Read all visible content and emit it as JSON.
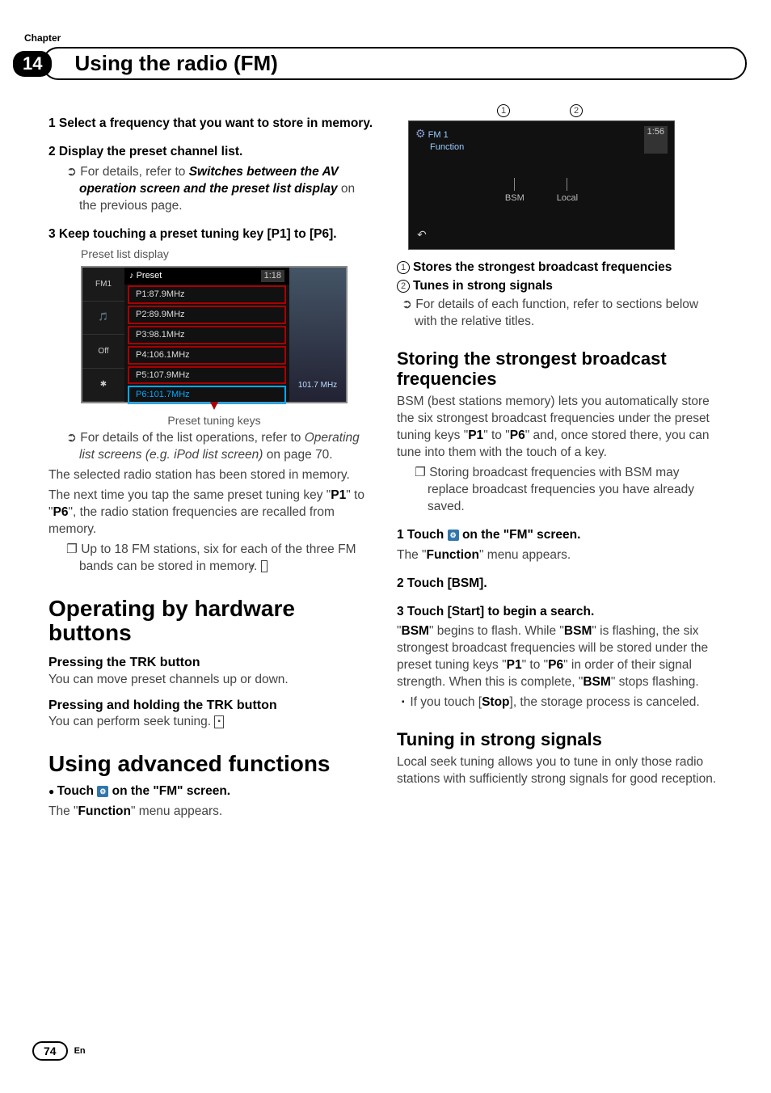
{
  "chapter_label": "Chapter",
  "chapter_number": "14",
  "page_title": "Using the radio (FM)",
  "left": {
    "step1": "1    Select a frequency that you want to store in memory.",
    "step2": "2    Display the preset channel list.",
    "step2_sub_lead": "For details, refer to ",
    "step2_sub_bold": "Switches between the AV operation screen and the preset list display",
    "step2_sub_tail": " on the previous page.",
    "step3": "3    Keep touching a preset tuning key [P1] to [P6].",
    "preset_caption_top": "Preset list display",
    "preset_header_label": "Preset",
    "preset_header_clock": "1:18",
    "side_fm": "FM1",
    "side_off": "Off",
    "presets": [
      "P1:87.9MHz",
      "P2:89.9MHz",
      "P3:98.1MHz",
      "P4:106.1MHz",
      "P5:107.9MHz",
      "P6:101.7MHz"
    ],
    "right_freq": "101.7 MHz",
    "preset_caption_bottom": "Preset tuning keys",
    "sub_list_lead": "For details of the list operations, refer to ",
    "sub_list_ital": "Operating list screens (e.g. iPod list screen)",
    "sub_list_tail": " on page 70.",
    "stored_line1": "The selected radio station has been stored in memory.",
    "stored_line2a": "The next time you tap the same preset tuning key \"",
    "p1": "P1",
    "to": "\" to \"",
    "p6": "P6",
    "stored_line2b": "\", the radio station frequencies are recalled from memory.",
    "note1a": "Up to 18 FM stations, six for each of the three FM bands can be stored in memory.",
    "h2_ops": "Operating by hardware buttons",
    "h4_press": "Pressing the TRK button",
    "press_body": "You can move preset channels up or down.",
    "h4_hold": "Pressing and holding the TRK button",
    "hold_body": "You can perform seek tuning.",
    "h2_adv": "Using advanced functions",
    "adv_dot_a": "Touch ",
    "adv_dot_b": " on the \"FM\" screen.",
    "func_menu": "The \"",
    "func_word": "Function",
    "func_menu_tail": "\" menu appears."
  },
  "right": {
    "label1": "1",
    "label2": "2",
    "fs_fm": "FM  1",
    "fs_func": "Function",
    "fs_clock": "1:56",
    "fs_bsm": "BSM",
    "fs_local": "Local",
    "item1": "Stores the strongest broadcast frequencies",
    "item2": "Tunes in strong signals",
    "item_sub": "For details of each function, refer to sections below with the relative titles.",
    "h3_store": "Storing the strongest broadcast frequencies",
    "store_p1a": "BSM (best stations memory) lets you automatically store the six strongest broadcast frequencies under the preset tuning keys \"",
    "p1": "P1",
    "p6": "P6",
    "store_p1b": "\" to \"",
    "store_p1c": "\" and, once stored there, you can tune into them with the touch of a key.",
    "store_note": "Storing broadcast frequencies with BSM may replace broadcast frequencies you have already saved.",
    "s1a": "1    Touch ",
    "s1b": " on the \"FM\" screen.",
    "s1_body_a": "The \"",
    "s1_body_b": "\" menu appears.",
    "s2": "2    Touch [BSM].",
    "s3": "3    Touch [Start] to begin a search.",
    "s3_a": "\"",
    "bsm": "BSM",
    "s3_b": "\" begins to flash. While \"",
    "s3_c": "\" is flashing, the six strongest broadcast frequencies will be stored under the preset tuning keys \"",
    "s3_d": "\" to \"",
    "s3_e": "\" in order of their signal strength. When this is complete, \"",
    "s3_f": "\" stops flashing.",
    "s3_stop_a": "If you touch [",
    "stop": "Stop",
    "s3_stop_b": "], the storage process is canceled.",
    "h3_tune": "Tuning in strong signals",
    "tune_body": "Local seek tuning allows you to tune in only those radio stations with sufficiently strong signals for good reception."
  },
  "footer": {
    "page": "74",
    "lang": "En"
  }
}
